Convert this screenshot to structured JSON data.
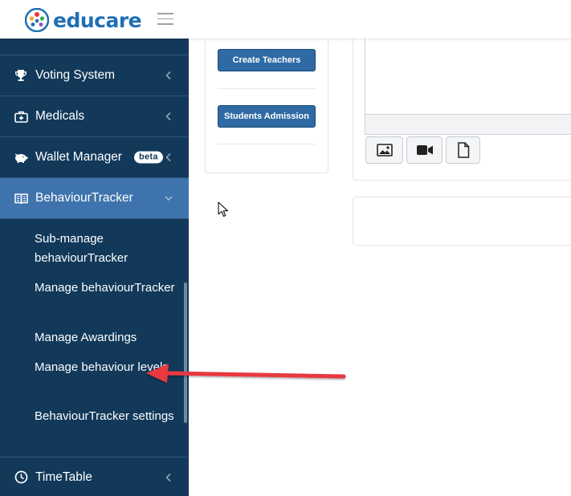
{
  "header": {
    "brand_name": "educare",
    "logo_icon": "people-circle-logo",
    "menu_icon": "hamburger-icon"
  },
  "sidebar": {
    "items": [
      {
        "label": "Voting System",
        "icon": "trophy-icon"
      },
      {
        "label": "Medicals",
        "icon": "medkit-icon"
      },
      {
        "label": "Wallet Manager",
        "icon": "piggy-bank-icon",
        "badge": "beta"
      },
      {
        "label": "BehaviourTracker",
        "icon": "book-icon",
        "active": true
      },
      {
        "label": "TimeTable",
        "icon": "clock-icon"
      }
    ],
    "sub_items": [
      {
        "label": "Sub-manage behaviourTracker"
      },
      {
        "label": "Manage behaviourTracker"
      },
      {
        "label": "Manage Awardings"
      },
      {
        "label": "Manage behaviour levels"
      },
      {
        "label": "BehaviourTracker settings"
      }
    ]
  },
  "main": {
    "buttons": {
      "create_teachers": "Create Teachers",
      "students_admission": "Students Admission"
    },
    "editor_tools": [
      "image-icon",
      "video-icon",
      "file-icon"
    ]
  },
  "colors": {
    "sidebar_bg": "#12395a",
    "sidebar_active": "#3f73ad",
    "brand_blue": "#1f6fb4",
    "button_blue": "#2f6aa4",
    "annotation_arrow": "#e8393f"
  }
}
